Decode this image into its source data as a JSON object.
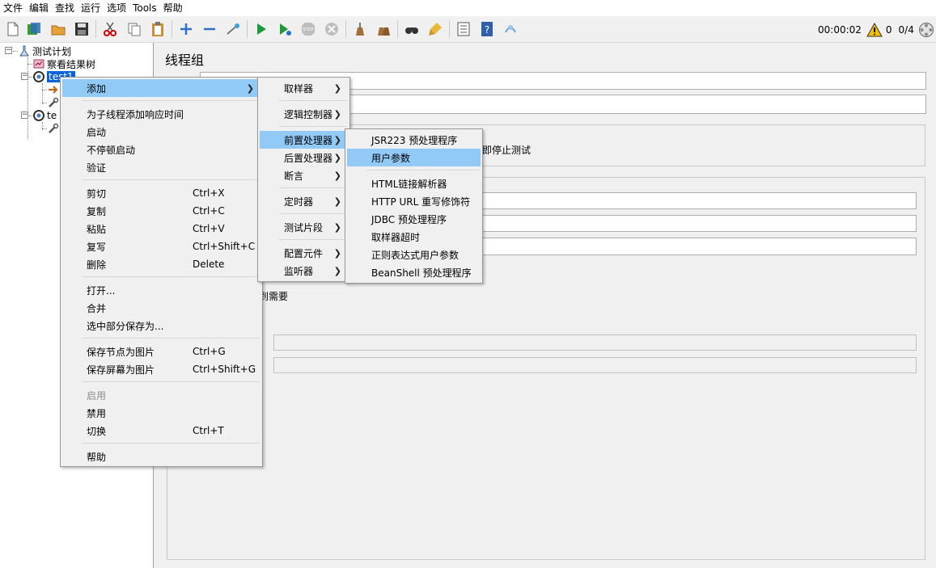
{
  "menubar": [
    "文件",
    "编辑",
    "查找",
    "运行",
    "选项",
    "Tools",
    "帮助"
  ],
  "toolbar": {
    "timer": "00:00:02",
    "warn_count": "0",
    "thread_ratio": "0/4"
  },
  "tree": {
    "root": "测试计划",
    "child1": "察看结果树",
    "child2": "test1",
    "child3": "te"
  },
  "panel": {
    "title": "线程组",
    "partial_text_1": "即停止测试",
    "partial_text_2": "到需要"
  },
  "context_menu": {
    "items": [
      {
        "label": "添加",
        "accel": "",
        "submenu": true
      },
      {
        "label": "为子线程添加响应时间",
        "accel": ""
      },
      {
        "label": "启动",
        "accel": ""
      },
      {
        "label": "不停顿启动",
        "accel": ""
      },
      {
        "label": "验证",
        "accel": ""
      },
      {
        "label": "剪切",
        "accel": "Ctrl+X"
      },
      {
        "label": "复制",
        "accel": "Ctrl+C"
      },
      {
        "label": "粘贴",
        "accel": "Ctrl+V"
      },
      {
        "label": "复写",
        "accel": "Ctrl+Shift+C"
      },
      {
        "label": "删除",
        "accel": "Delete"
      },
      {
        "label": "打开...",
        "accel": ""
      },
      {
        "label": "合并",
        "accel": ""
      },
      {
        "label": "选中部分保存为...",
        "accel": ""
      },
      {
        "label": "保存节点为图片",
        "accel": "Ctrl+G"
      },
      {
        "label": "保存屏幕为图片",
        "accel": "Ctrl+Shift+G"
      },
      {
        "label": "启用",
        "accel": ""
      },
      {
        "label": "禁用",
        "accel": ""
      },
      {
        "label": "切换",
        "accel": "Ctrl+T"
      },
      {
        "label": "帮助",
        "accel": ""
      }
    ]
  },
  "add_submenu": {
    "items": [
      {
        "label": "取样器"
      },
      {
        "label": "逻辑控制器"
      },
      {
        "label": "前置处理器"
      },
      {
        "label": "后置处理器"
      },
      {
        "label": "断言"
      },
      {
        "label": "定时器"
      },
      {
        "label": "测试片段"
      },
      {
        "label": "配置元件"
      },
      {
        "label": "监听器"
      }
    ]
  },
  "preprocessor_submenu": {
    "items": [
      {
        "label": "JSR223 预处理程序"
      },
      {
        "label": "用户参数"
      },
      {
        "label": "HTML链接解析器"
      },
      {
        "label": "HTTP URL 重写修饰符"
      },
      {
        "label": "JDBC 预处理程序"
      },
      {
        "label": "取样器超时"
      },
      {
        "label": "正则表达式用户参数"
      },
      {
        "label": "BeanShell 预处理程序"
      }
    ]
  }
}
